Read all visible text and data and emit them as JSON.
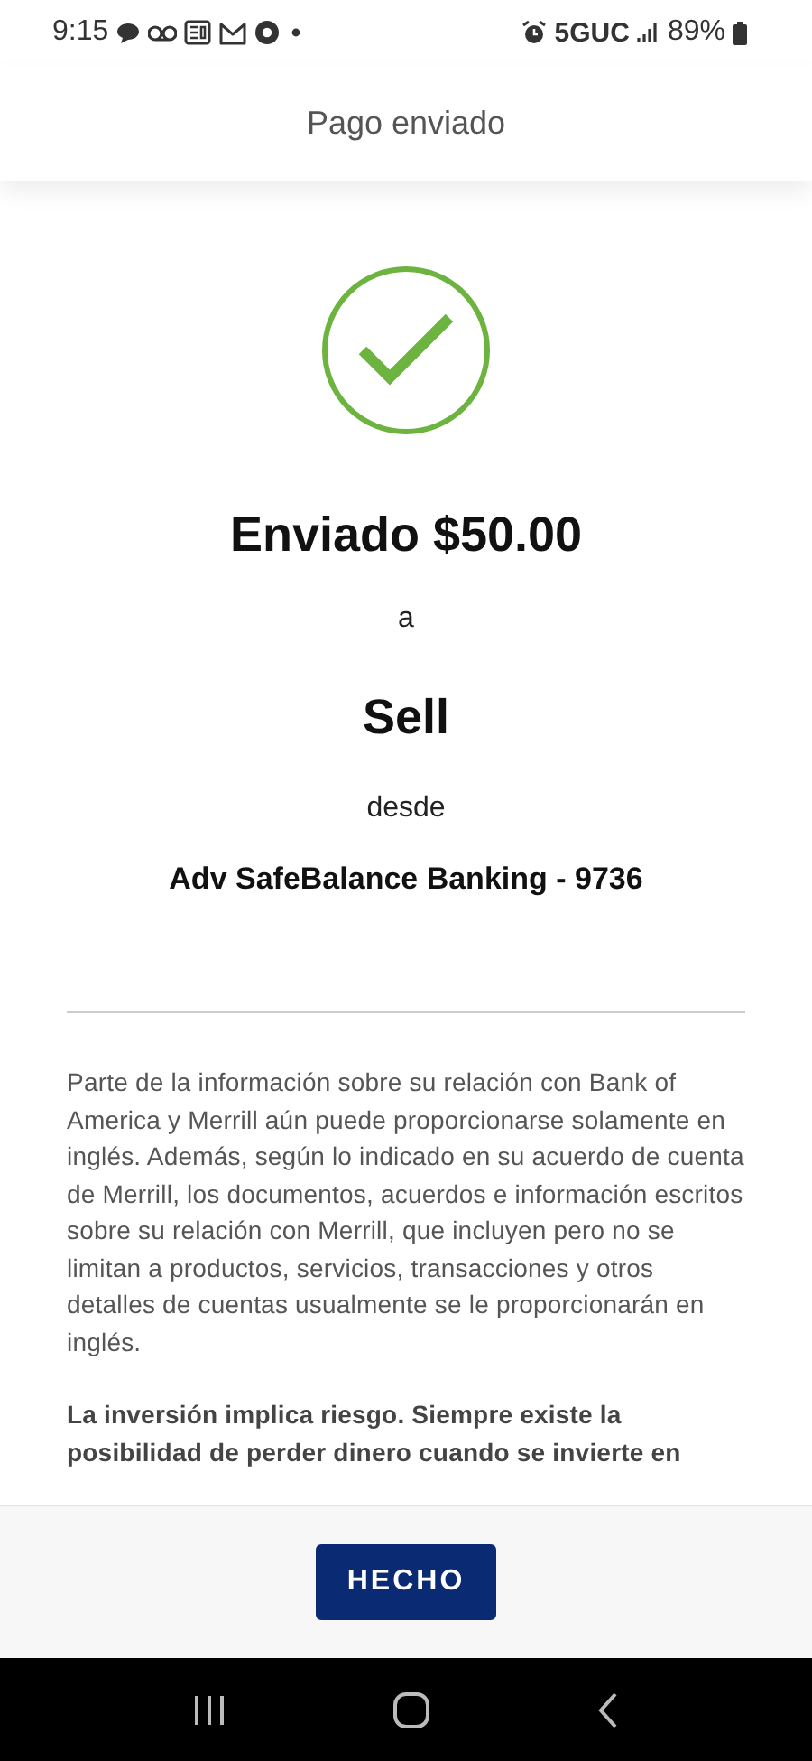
{
  "status_bar": {
    "time": "9:15",
    "network": "5GUC",
    "battery": "89%"
  },
  "header": {
    "title": "Pago enviado"
  },
  "confirmation": {
    "amount_line": "Enviado $50.00",
    "to_label": "a",
    "recipient": "Sell",
    "from_label": "desde",
    "account": "Adv SafeBalance Banking - 9736"
  },
  "disclosures": [
    {
      "text": "Parte de la información sobre su relación con Bank of America y Merrill aún puede proporcionarse solamente en inglés. Además, según lo indicado en su acuerdo de cuenta de Merrill, los documentos, acuerdos e información escritos sobre su relación con Merrill, que incluyen pero no se limitan a productos, servicios, transacciones y otros detalles de cuentas usualmente se le proporcionarán en inglés.",
      "emphasis": false
    },
    {
      "text": "La inversión implica riesgo. Siempre existe la posibilidad de perder dinero cuando se invierte en",
      "emphasis": true
    }
  ],
  "footer": {
    "button": "HECHO"
  }
}
